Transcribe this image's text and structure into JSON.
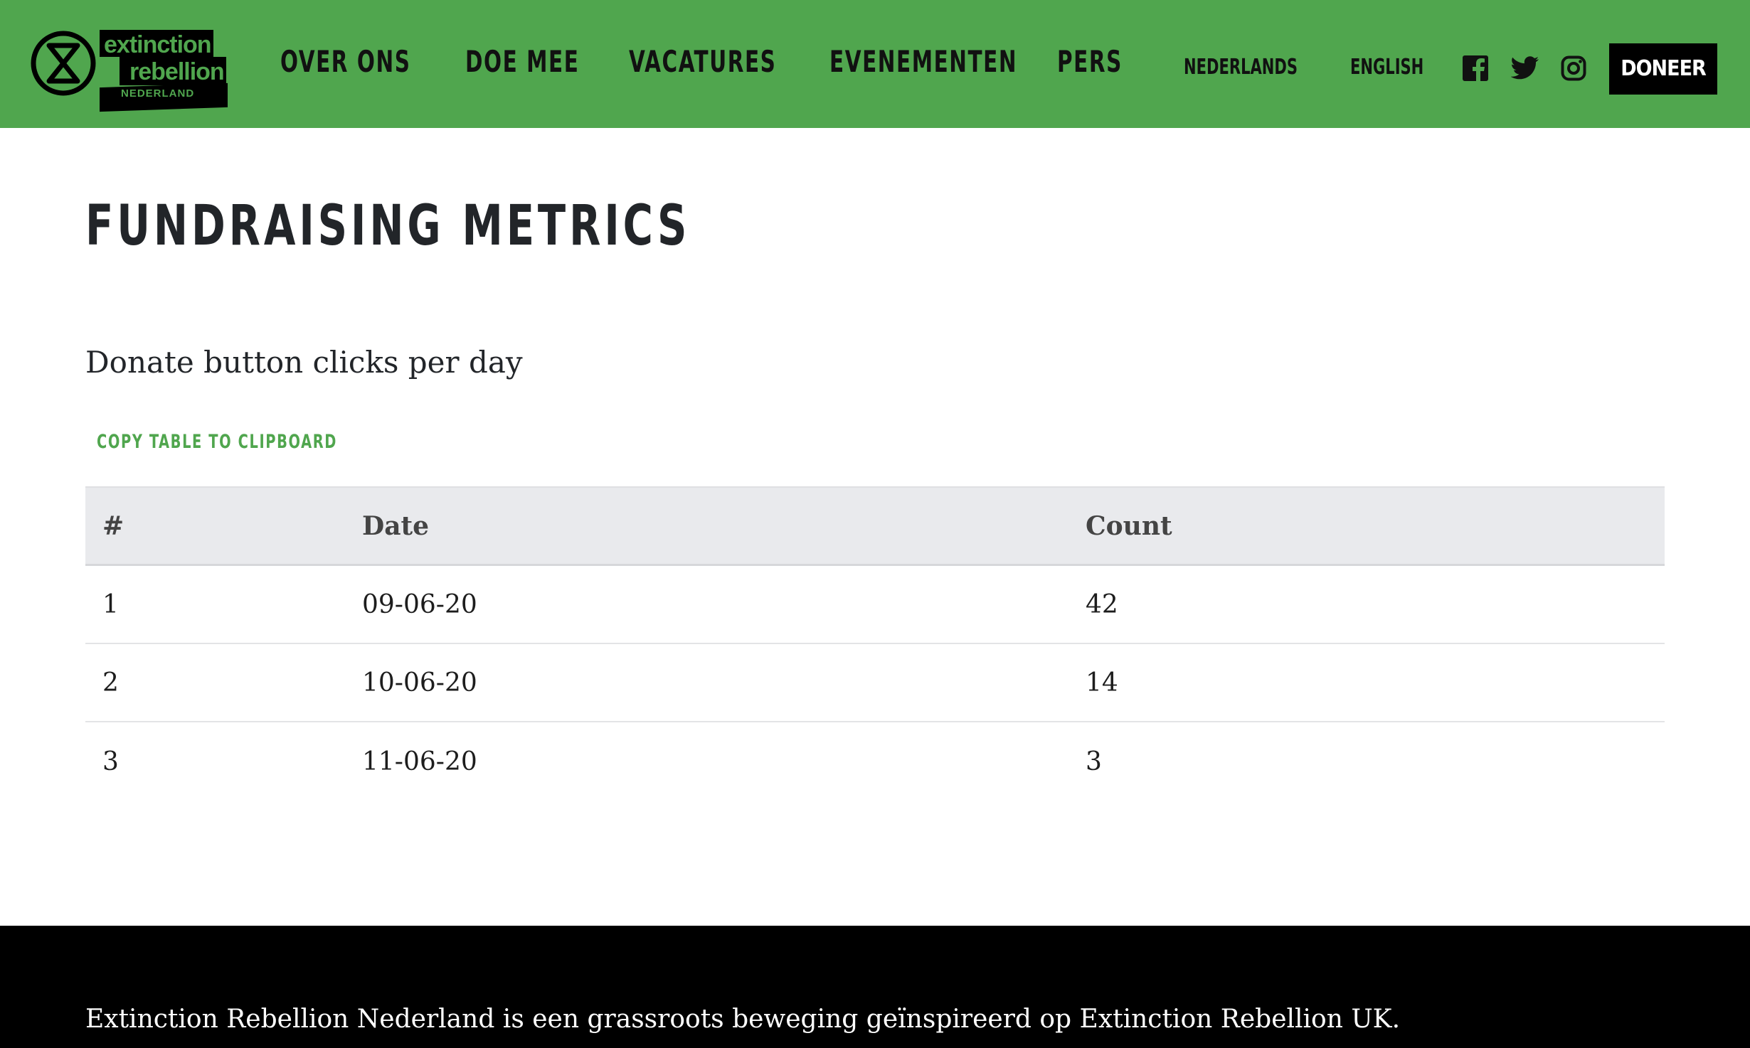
{
  "header": {
    "logo": {
      "line1": "extinction",
      "line2": "rebellion",
      "line3": "NEDERLAND"
    },
    "nav": [
      {
        "label": "OVER ONS"
      },
      {
        "label": "DOE MEE"
      },
      {
        "label": "VACATURES"
      },
      {
        "label": "EVENEMENTEN"
      },
      {
        "label": "PERS"
      }
    ],
    "languages": [
      {
        "label": "NEDERLANDS"
      },
      {
        "label": "ENGLISH"
      }
    ],
    "social_icons": [
      "facebook-icon",
      "twitter-icon",
      "instagram-icon"
    ],
    "donate_label": "DONEER"
  },
  "main": {
    "title": "FUNDRAISING METRICS",
    "subtitle": "Donate button clicks per day",
    "copy_button_label": "COPY TABLE TO CLIPBOARD",
    "table": {
      "headers": [
        "#",
        "Date",
        "Count"
      ],
      "rows": [
        [
          "1",
          "09-06-20",
          "42"
        ],
        [
          "2",
          "10-06-20",
          "14"
        ],
        [
          "3",
          "11-06-20",
          "3"
        ]
      ]
    }
  },
  "footer": {
    "text": "Extinction Rebellion Nederland is een grassroots beweging geïnspireerd op Extinction Rebellion UK."
  },
  "colors": {
    "brand_green": "#50a64e",
    "black": "#000000",
    "table_header_bg": "#e9eaed",
    "text_dark": "#222529"
  }
}
